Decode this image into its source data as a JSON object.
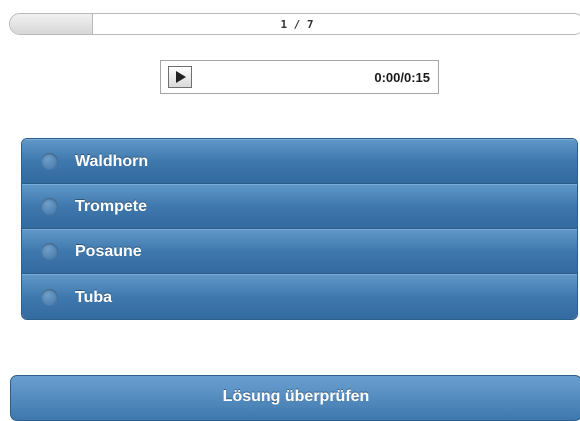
{
  "progress": {
    "text": "1 / 7",
    "current": 1,
    "total": 7
  },
  "player": {
    "play_icon": "play-icon",
    "time": "0:00/0:15"
  },
  "options": [
    {
      "label": "Waldhorn"
    },
    {
      "label": "Trompete"
    },
    {
      "label": "Posaune"
    },
    {
      "label": "Tuba"
    }
  ],
  "submit": {
    "label": "Lösung überprüfen"
  },
  "colors": {
    "accent": "#3f78ad",
    "accent_light": "#5f97c8",
    "border": "#2d5e8c"
  }
}
